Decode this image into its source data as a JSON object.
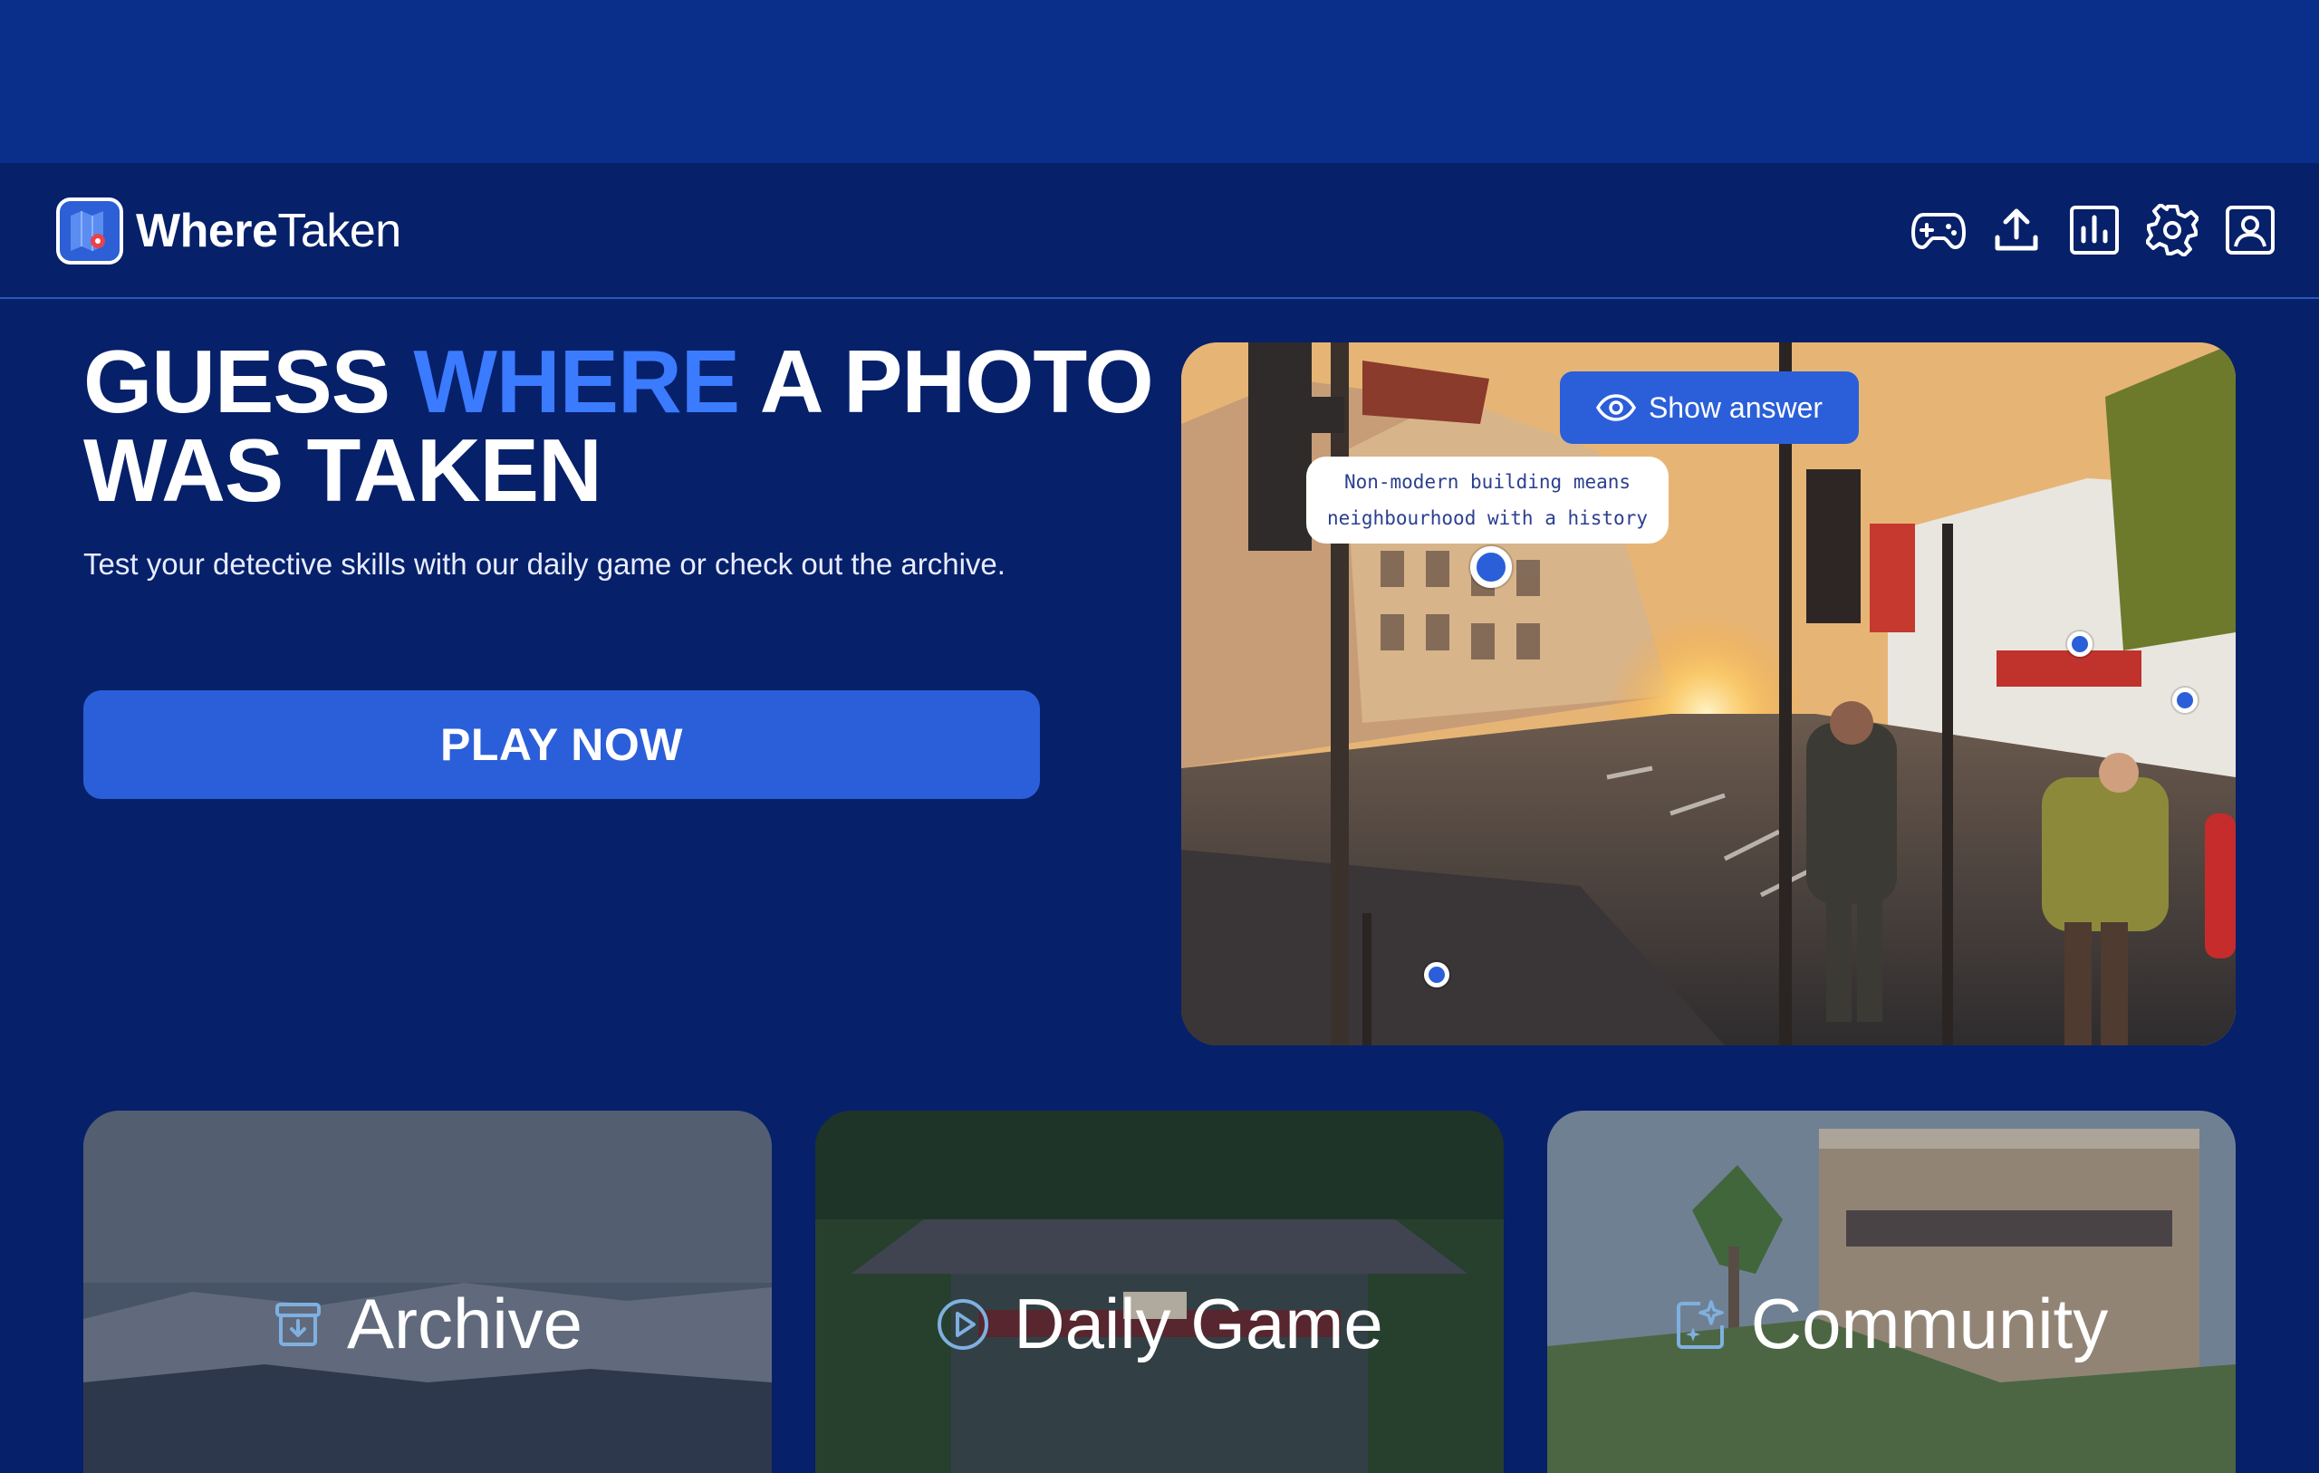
{
  "app": {
    "brand_bold": "Where",
    "brand_regular": "Taken"
  },
  "header": {
    "icons": [
      "gamepad-icon",
      "upload-icon",
      "stats-icon",
      "gear-icon",
      "profile-icon"
    ]
  },
  "hero": {
    "title_part1": "GUESS ",
    "title_accent": "WHERE",
    "title_part2": " A PHOTO WAS TAKEN",
    "subtitle": "Test your detective skills with our daily game or check out the archive.",
    "play_label": "PLAY NOW"
  },
  "photo": {
    "show_answer_label": "Show answer",
    "hint_line1": "Non-modern building means",
    "hint_line2": "neighbourhood with a history"
  },
  "cards": {
    "archive": "Archive",
    "daily": "Daily Game",
    "community": "Community"
  },
  "colors": {
    "background": "#06206a",
    "top_band": "#0a2f8a",
    "accent": "#3b7bff",
    "button": "#2b5fd9"
  }
}
